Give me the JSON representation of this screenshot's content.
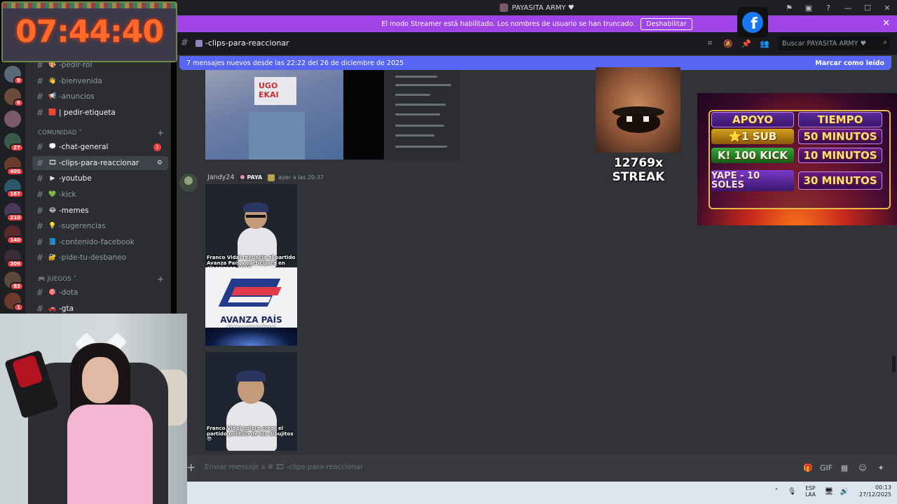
{
  "window": {
    "title": "PAYASITA ARMY ♥"
  },
  "timer": {
    "value": "07:44:40"
  },
  "banner": {
    "text": "El modo Streamer está habilitado. Los nombres de usuario se han truncado.",
    "button": "Deshabilitar"
  },
  "channel": {
    "name": "-clips-para-reaccionar",
    "search_placeholder": "Buscar PAYASITA ARMY ♥"
  },
  "newbar": {
    "text": "7 mensajes nuevos desde las 22:22 del 26 de diciembre de 2025",
    "action": "Marcar como leído"
  },
  "servers": {
    "badges": [
      "9",
      "6",
      "",
      "27",
      "405",
      "167",
      "210",
      "140",
      "309",
      "83",
      "1"
    ]
  },
  "sidebar": {
    "items_top": [
      {
        "label": "-pedir-rol",
        "emoji": "🎨",
        "bold": false
      },
      {
        "label": "-bienvenida",
        "emoji": "👋",
        "bold": false
      },
      {
        "label": "-anuncios",
        "emoji": "📢",
        "bold": false
      },
      {
        "label": "| pedir-etiqueta",
        "emoji": "🟥",
        "bold": true
      }
    ],
    "cat_comunidad": "COMUNIDAD",
    "items_comunidad": [
      {
        "label": "-chat-general",
        "emoji": "💭",
        "bold": true,
        "badge": "1"
      },
      {
        "label": "-clips-para-reaccionar",
        "emoji": "🎞",
        "bold": true,
        "active": true
      },
      {
        "label": "-youtube",
        "emoji": "▶",
        "bold": true
      },
      {
        "label": "-kick",
        "emoji": "💚",
        "bold": false
      },
      {
        "label": "-memes",
        "emoji": "😂",
        "bold": true
      },
      {
        "label": "-sugerencias",
        "emoji": "💡",
        "bold": false
      },
      {
        "label": "-contenido-facebook",
        "emoji": "📘",
        "bold": false
      },
      {
        "label": "-pide-tu-desbaneo",
        "emoji": "🔐",
        "bold": false
      }
    ],
    "cat_juegos": "JUEGOS",
    "items_juegos": [
      {
        "label": "-dota",
        "emoji": "🎯",
        "bold": false
      },
      {
        "label": "-gta",
        "emoji": "🚗",
        "bold": true
      }
    ]
  },
  "message": {
    "username": "Jandy24",
    "role": "PAYA",
    "timestamp": "ayer a las 20:37",
    "clip1_caption": "Franco Vidal renuncia al partido Avanza País y participará en elecciones 2026",
    "avanza_name": "AVANZA PAÍS",
    "avanza_handle": "Francovidaloficial",
    "clip2_caption": "Franco Vidal quiere crear el partido político de los dibujitos 😎",
    "shirt_text": "UGO EKAI"
  },
  "overlays": {
    "streak": "12769x STREAK",
    "subathon": {
      "header": [
        "APOYO",
        "TIEMPO"
      ],
      "rows": [
        [
          "⭐1 SUB",
          "50 MINUTOS"
        ],
        [
          "K! 100 KICK",
          "10 MINUTOS"
        ],
        [
          "YAPE - 10 SOLES",
          "30 MINUTOS"
        ]
      ]
    }
  },
  "composer": {
    "placeholder": "Enviar mensaje a # 🎞 -clips-para-reaccionar"
  },
  "taskbar": {
    "lang_top": "ESP",
    "lang_bottom": "LAA",
    "time": "00:13",
    "date": "27/12/2025"
  },
  "colors": {
    "accent": "#5865f2",
    "banner": "#a044e8",
    "badge": "#f23f43"
  }
}
